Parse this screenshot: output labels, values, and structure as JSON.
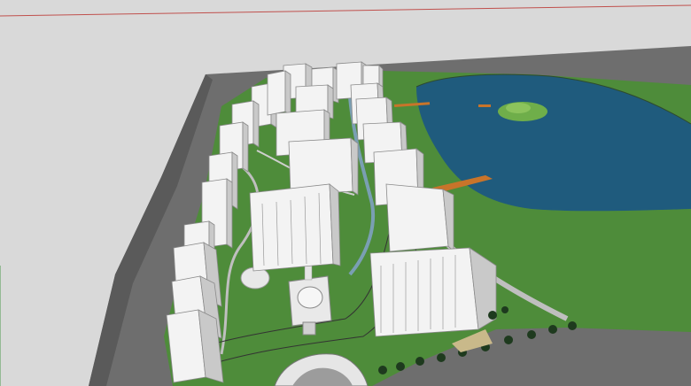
{
  "viewport": {
    "kind": "3d-model-view",
    "colors": {
      "sky": "#d9d9d9",
      "ground": "#6f6f6f",
      "grass": "#4e8c3a",
      "lake": "#1f5b7d",
      "building": "#f3f3f3",
      "building_shade": "#c9c9c9",
      "path": "#bfbfbf",
      "dock": "#c8742a",
      "axis_red": "#c0504d"
    }
  }
}
